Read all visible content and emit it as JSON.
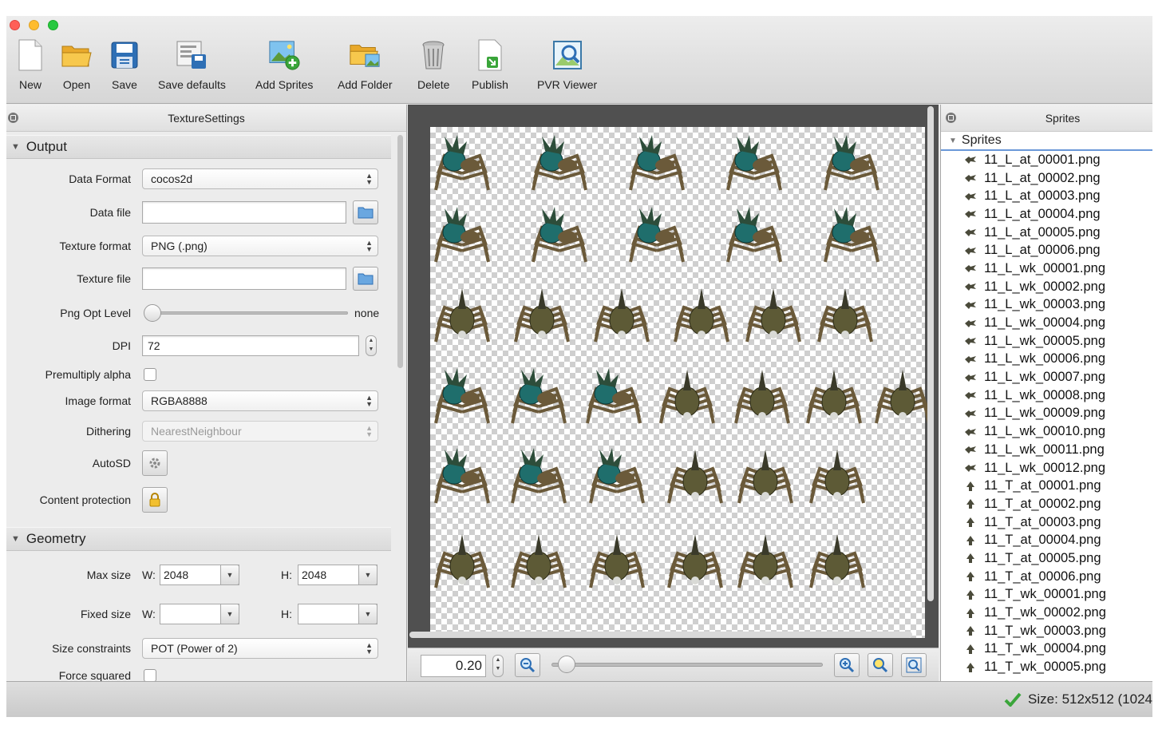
{
  "toolbar": {
    "buttons": [
      {
        "label": "New",
        "icon": "new-document-icon"
      },
      {
        "label": "Open",
        "icon": "folder-open-icon"
      },
      {
        "label": "Save",
        "icon": "floppy-disk-icon"
      },
      {
        "label": "Save defaults",
        "icon": "save-defaults-icon"
      },
      {
        "label": "Add Sprites",
        "icon": "add-sprites-icon"
      },
      {
        "label": "Add Folder",
        "icon": "add-folder-icon"
      },
      {
        "label": "Delete",
        "icon": "trash-can-icon"
      },
      {
        "label": "Publish",
        "icon": "publish-icon"
      },
      {
        "label": "PVR Viewer",
        "icon": "pvr-viewer-icon"
      }
    ]
  },
  "settings": {
    "title": "TextureSettings",
    "output": {
      "header": "Output",
      "data_format": {
        "label": "Data Format",
        "value": "cocos2d"
      },
      "data_file": {
        "label": "Data file",
        "value": ""
      },
      "texture_format": {
        "label": "Texture format",
        "value": "PNG (.png)"
      },
      "texture_file": {
        "label": "Texture file",
        "value": ""
      },
      "png_opt_level": {
        "label": "Png Opt Level",
        "value_text": "none",
        "level": 0
      },
      "dpi": {
        "label": "DPI",
        "value": "72"
      },
      "premultiply_alpha": {
        "label": "Premultiply alpha",
        "checked": false
      },
      "image_format": {
        "label": "Image format",
        "value": "RGBA8888"
      },
      "dithering": {
        "label": "Dithering",
        "value": "NearestNeighbour"
      },
      "autosd": {
        "label": "AutoSD"
      },
      "content_protection": {
        "label": "Content protection"
      }
    },
    "geometry": {
      "header": "Geometry",
      "max_size": {
        "label": "Max size",
        "w_label": "W:",
        "w": "2048",
        "h_label": "H:",
        "h": "2048"
      },
      "fixed_size": {
        "label": "Fixed size",
        "w_label": "W:",
        "w": "",
        "h_label": "H:",
        "h": ""
      },
      "size_constraints": {
        "label": "Size constraints",
        "value": "POT (Power of 2)"
      },
      "force_squared": {
        "label": "Force squared",
        "checked": false
      }
    }
  },
  "zoom": {
    "value": "0.20"
  },
  "sprites": {
    "panel_title": "Sprites",
    "root_label": "Sprites",
    "items": [
      "11_L_at_00001.png",
      "11_L_at_00002.png",
      "11_L_at_00003.png",
      "11_L_at_00004.png",
      "11_L_at_00005.png",
      "11_L_at_00006.png",
      "11_L_wk_00001.png",
      "11_L_wk_00002.png",
      "11_L_wk_00003.png",
      "11_L_wk_00004.png",
      "11_L_wk_00005.png",
      "11_L_wk_00006.png",
      "11_L_wk_00007.png",
      "11_L_wk_00008.png",
      "11_L_wk_00009.png",
      "11_L_wk_00010.png",
      "11_L_wk_00011.png",
      "11_L_wk_00012.png",
      "11_T_at_00001.png",
      "11_T_at_00002.png",
      "11_T_at_00003.png",
      "11_T_at_00004.png",
      "11_T_at_00005.png",
      "11_T_at_00006.png",
      "11_T_wk_00001.png",
      "11_T_wk_00002.png",
      "11_T_wk_00003.png",
      "11_T_wk_00004.png",
      "11_T_wk_00005.png"
    ]
  },
  "status": {
    "text": "Size: 512x512 (1024"
  },
  "colors": {
    "accent": "#6a98d8",
    "sprite_body": "#1f6e6c",
    "sprite_legs": "#6b5a3a"
  }
}
